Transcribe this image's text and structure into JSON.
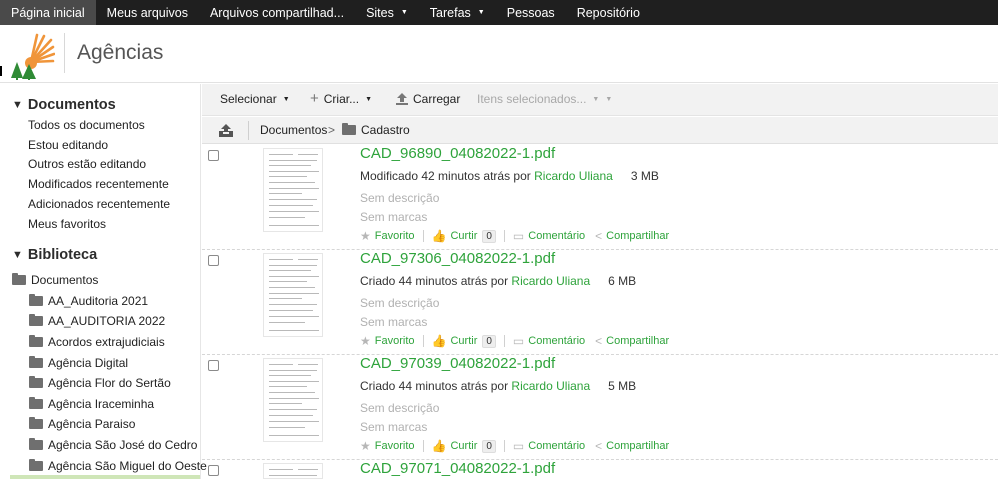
{
  "nav": {
    "items": [
      {
        "label": "Página inicial",
        "active": true,
        "has_caret": false
      },
      {
        "label": "Meus arquivos",
        "active": false,
        "has_caret": false
      },
      {
        "label": "Arquivos compartilhad...",
        "active": false,
        "has_caret": false
      },
      {
        "label": "Sites",
        "active": false,
        "has_caret": true
      },
      {
        "label": "Tarefas",
        "active": false,
        "has_caret": true
      },
      {
        "label": "Pessoas",
        "active": false,
        "has_caret": false
      },
      {
        "label": "Repositório",
        "active": false,
        "has_caret": false
      }
    ]
  },
  "header": {
    "site_title": "Agências"
  },
  "sidebar": {
    "documents_heading": "Documentos",
    "filters": [
      "Todos os documentos",
      "Estou editando",
      "Outros estão editando",
      "Modificados recentemente",
      "Adicionados recentemente",
      "Meus favoritos"
    ],
    "library_heading": "Biblioteca",
    "root_folder": "Documentos",
    "folders": [
      "AA_Auditoria 2021",
      "AA_AUDITORIA 2022",
      "Acordos extrajudiciais",
      "Agência Digital",
      "Agência Flor do Sertão",
      "Agência Iraceminha",
      "Agência Paraiso",
      "Agência São José do Cedro",
      "Agência São Miguel do Oeste"
    ]
  },
  "toolbar": {
    "select_label": "Selecionar",
    "create_label": "Criar...",
    "upload_label": "Carregar",
    "selected_items_label": "Itens selecionados..."
  },
  "breadcrumb": {
    "root": "Documentos",
    "separator": ">",
    "current": "Cadastro"
  },
  "documents": [
    {
      "name": "CAD_96890_04082022-1.pdf",
      "action": "Modificado 42 minutos atrás por",
      "user": "Ricardo Uliana",
      "size": "3 MB",
      "description": "Sem descrição",
      "tags": "Sem marcas",
      "favorite_label": "Favorito",
      "like_label": "Curtir",
      "like_count": "0",
      "comment_label": "Comentário",
      "share_label": "Compartilhar"
    },
    {
      "name": "CAD_97306_04082022-1.pdf",
      "action": "Criado 44 minutos atrás por",
      "user": "Ricardo Uliana",
      "size": "6 MB",
      "description": "Sem descrição",
      "tags": "Sem marcas",
      "favorite_label": "Favorito",
      "like_label": "Curtir",
      "like_count": "0",
      "comment_label": "Comentário",
      "share_label": "Compartilhar"
    },
    {
      "name": "CAD_97039_04082022-1.pdf",
      "action": "Criado 44 minutos atrás por",
      "user": "Ricardo Uliana",
      "size": "5 MB",
      "description": "Sem descrição",
      "tags": "Sem marcas",
      "favorite_label": "Favorito",
      "like_label": "Curtir",
      "like_count": "0",
      "comment_label": "Comentário",
      "share_label": "Compartilhar"
    },
    {
      "name": "CAD_97071_04082022-1.pdf"
    }
  ],
  "colors": {
    "accent_green": "#2ea33b",
    "nav_bg": "#1f1f1f",
    "muted_text": "#b1b1b1"
  }
}
